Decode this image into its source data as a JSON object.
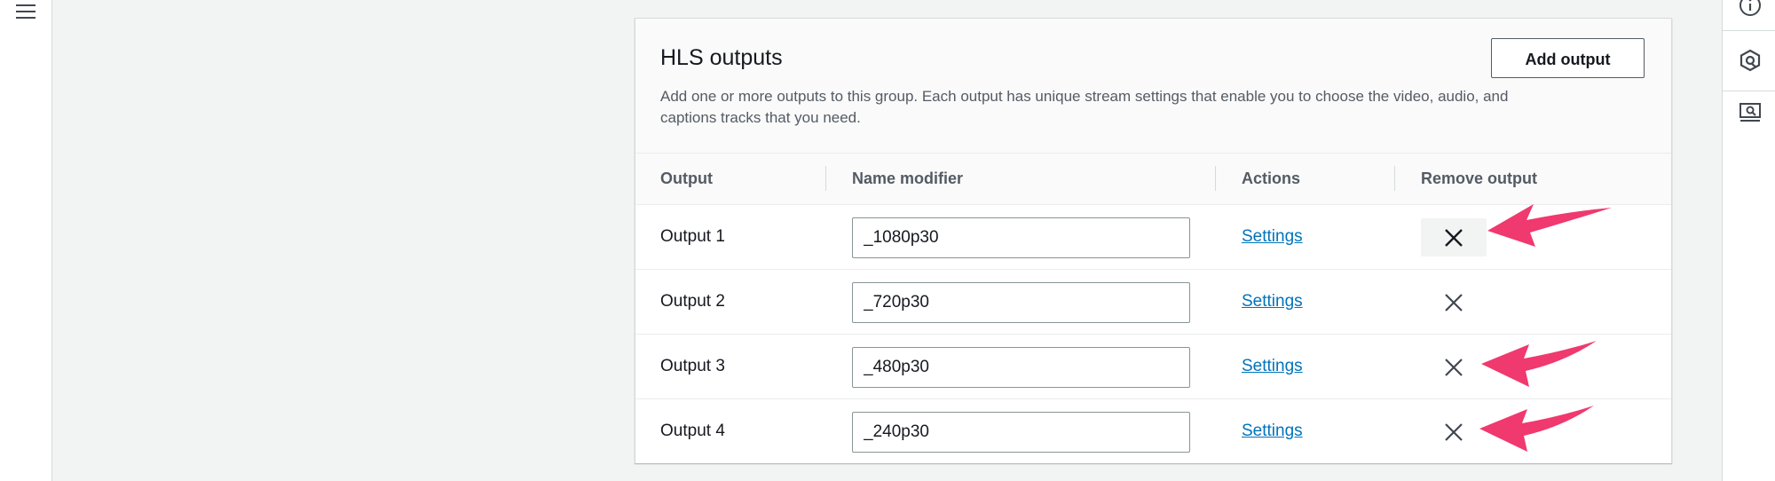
{
  "panel": {
    "title": "HLS outputs",
    "description": "Add one or more outputs to this group. Each output has unique stream settings that enable you to choose the video, audio, and captions tracks that you need.",
    "add_button_label": "Add output"
  },
  "table": {
    "headers": {
      "output": "Output",
      "name_modifier": "Name modifier",
      "actions": "Actions",
      "remove": "Remove output"
    },
    "rows": [
      {
        "output": "Output 1",
        "name_modifier": "_1080p30",
        "action": "Settings"
      },
      {
        "output": "Output 2",
        "name_modifier": "_720p30",
        "action": "Settings"
      },
      {
        "output": "Output 3",
        "name_modifier": "_480p30",
        "action": "Settings"
      },
      {
        "output": "Output 4",
        "name_modifier": "_240p30",
        "action": "Settings"
      }
    ]
  },
  "icons": {
    "nav": "menu-icon",
    "tools": [
      "info-icon",
      "settings-hex-icon",
      "screen-search-icon"
    ],
    "remove": "close-icon",
    "annotation": "arrow-icon"
  },
  "colors": {
    "link": "#0073bb",
    "annotation_arrow": "#f0396e",
    "background": "#f2f3f3"
  }
}
